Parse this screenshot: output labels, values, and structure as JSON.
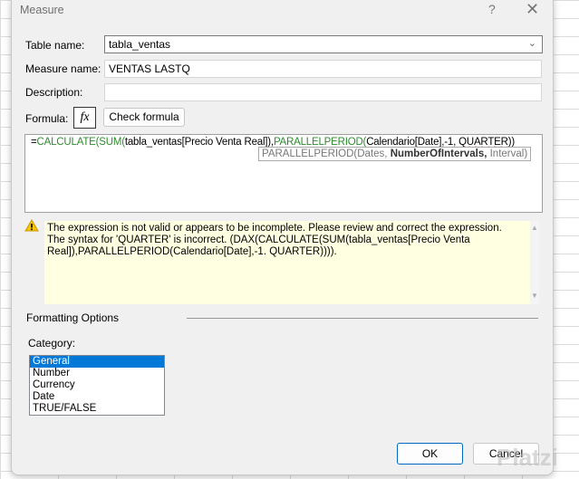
{
  "dialog": {
    "title": "Measure",
    "help": "?",
    "close": "✕"
  },
  "form": {
    "table_name_label": "Table name:",
    "table_name_value": "tabla_ventas",
    "measure_name_label": "Measure name:",
    "measure_name_value": "VENTAS LASTQ",
    "description_label": "Description:",
    "description_value": "",
    "formula_label": "Formula:",
    "fx_label": "fx",
    "check_formula": "Check formula"
  },
  "formula": {
    "p1": "=",
    "p2": "CALCULATE(SUM(",
    "p3": "tabla_ventas[Precio Venta Real]),",
    "p4": "PARALLELPERIOD(",
    "p5": "Calendario[Date],-1, ",
    "p6": "QUARTER",
    "p7": "))"
  },
  "tooltip": {
    "a": "PARALLELPERIOD(Dates, ",
    "b": "NumberOfIntervals,",
    "c": " Interval)"
  },
  "warning": {
    "line1": "The expression is not valid or appears to be incomplete. Please review and correct the expression.",
    "line2": "The syntax for 'QUARTER' is incorrect. (DAX(CALCULATE(SUM(tabla_ventas[Precio Venta Real]),PARALLELPERIOD(Calendario[Date],-1. QUARTER)))).",
    "scroll_up": "▲",
    "scroll_down": "▼"
  },
  "formatting": {
    "heading": "Formatting Options",
    "category_label": "Category:",
    "categories": [
      "General",
      "Number",
      "Currency",
      "Date",
      "TRUE/FALSE"
    ],
    "selected": "General"
  },
  "buttons": {
    "ok": "OK",
    "cancel": "Cancel"
  },
  "watermark": "Platzi"
}
